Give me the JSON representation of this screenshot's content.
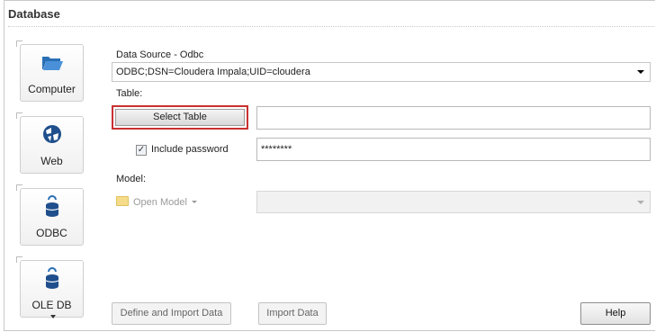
{
  "panel": {
    "title": "Database"
  },
  "sources": [
    {
      "label": "Computer",
      "icon": "folder-open-icon"
    },
    {
      "label": "Web",
      "icon": "globe-icon"
    },
    {
      "label": "ODBC",
      "icon": "database-icon"
    },
    {
      "label": "OLE DB",
      "icon": "database-icon"
    }
  ],
  "form": {
    "data_source_label": "Data Source -  Odbc",
    "connection_string": "ODBC;DSN=Cloudera Impala;UID=cloudera",
    "table_label": "Table:",
    "select_table_button": "Select Table",
    "table_value": "",
    "include_password_label": "Include password",
    "include_password_checked": true,
    "password_value": "********",
    "model_label": "Model:",
    "open_model_button": "Open Model",
    "model_value": ""
  },
  "footer": {
    "define_import_button": "Define and Import Data",
    "import_button": "Import Data",
    "help_button": "Help"
  },
  "colors": {
    "highlight_border": "#c93030",
    "accent_blue": "#2a6fb5"
  }
}
